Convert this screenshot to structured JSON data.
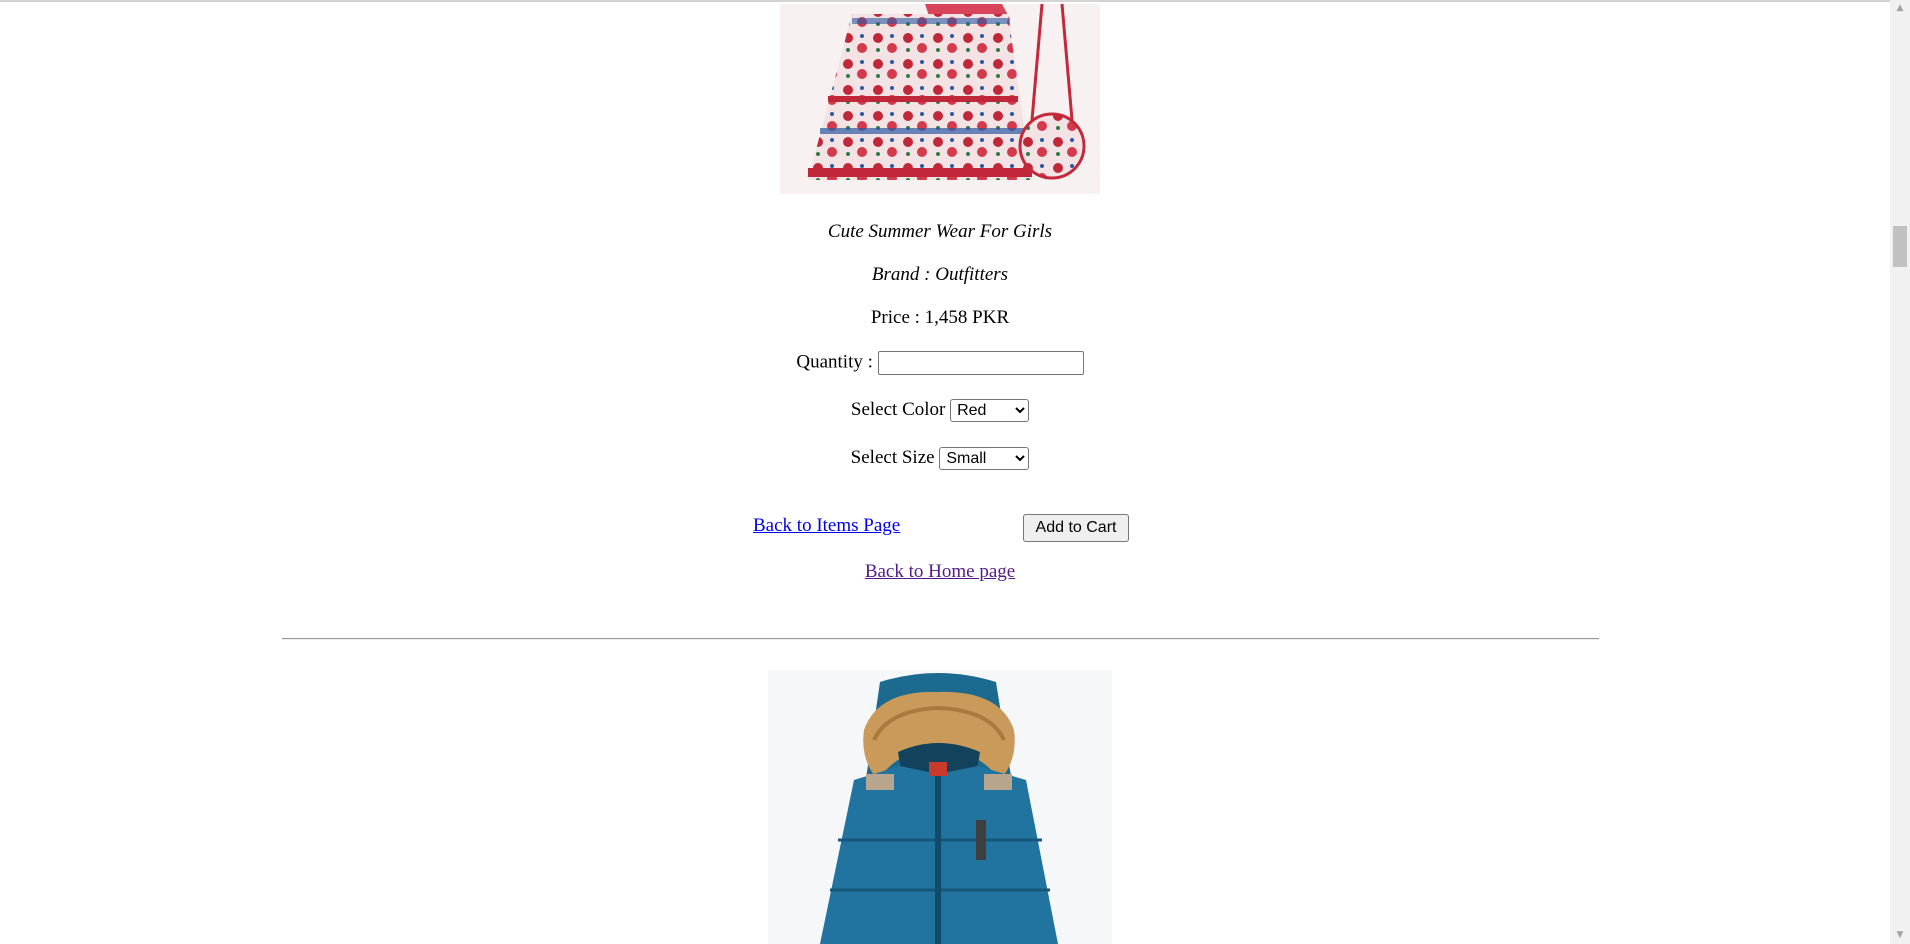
{
  "product": {
    "title": "Cute Summer Wear For Girls",
    "brand": "Brand : Outfitters",
    "price": "Price : 1,458 PKR"
  },
  "form": {
    "quantity_label": "Quantity :",
    "quantity_value": "",
    "color_label": "Select Color",
    "color_selected": "Red",
    "size_label": "Select Size",
    "size_selected": "Small"
  },
  "actions": {
    "back_items": "Back to Items Page ",
    "add_to_cart": "Add to Cart",
    "back_home": "Back to Home page"
  },
  "colors": {
    "link": "#0000ee",
    "visited_link": "#551a8b",
    "jacket": "#1f6f96",
    "fur": "#c99a5a"
  }
}
